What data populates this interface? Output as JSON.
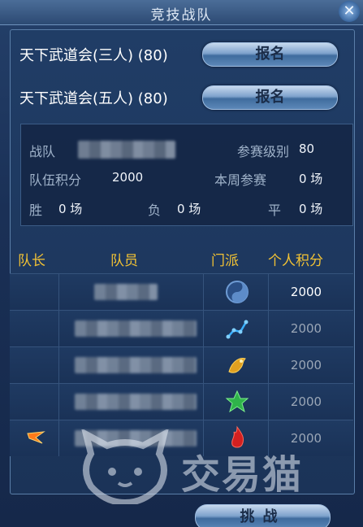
{
  "window": {
    "title": "竞技战队",
    "close_glyph": "✕"
  },
  "signup": [
    {
      "label": "天下武道会(三人) (80)",
      "button": "报名"
    },
    {
      "label": "天下武道会(五人) (80)",
      "button": "报名"
    }
  ],
  "team_info": {
    "team_label": "战队",
    "level_label": "参赛级别",
    "level_value": "80",
    "score_label": "队伍积分",
    "score_value": "2000",
    "weekly_label": "本周参赛",
    "weekly_value": "0 场",
    "win_label": "胜",
    "win_value": "0 场",
    "loss_label": "负",
    "loss_value": "0 场",
    "draw_label": "平",
    "draw_value": "0 场"
  },
  "table": {
    "headers": [
      "队长",
      "队员",
      "门派",
      "个人积分"
    ],
    "rows": [
      {
        "score": "2000",
        "faction_icon": "yin-yang-icon",
        "is_leader": false
      },
      {
        "score": "2000",
        "faction_icon": "constellation-icon",
        "is_leader": false
      },
      {
        "score": "2000",
        "faction_icon": "phoenix-icon",
        "is_leader": false
      },
      {
        "score": "2000",
        "faction_icon": "green-lotus-icon",
        "is_leader": false
      },
      {
        "score": "2000",
        "faction_icon": "red-flame-icon",
        "is_leader": true
      }
    ]
  },
  "challenge_button": "挑战",
  "watermark": {
    "text": "交易猫"
  },
  "colors": {
    "header_gold": "#f2c234",
    "score_white": "#ffffff",
    "score_gray": "#9aa6b6"
  }
}
